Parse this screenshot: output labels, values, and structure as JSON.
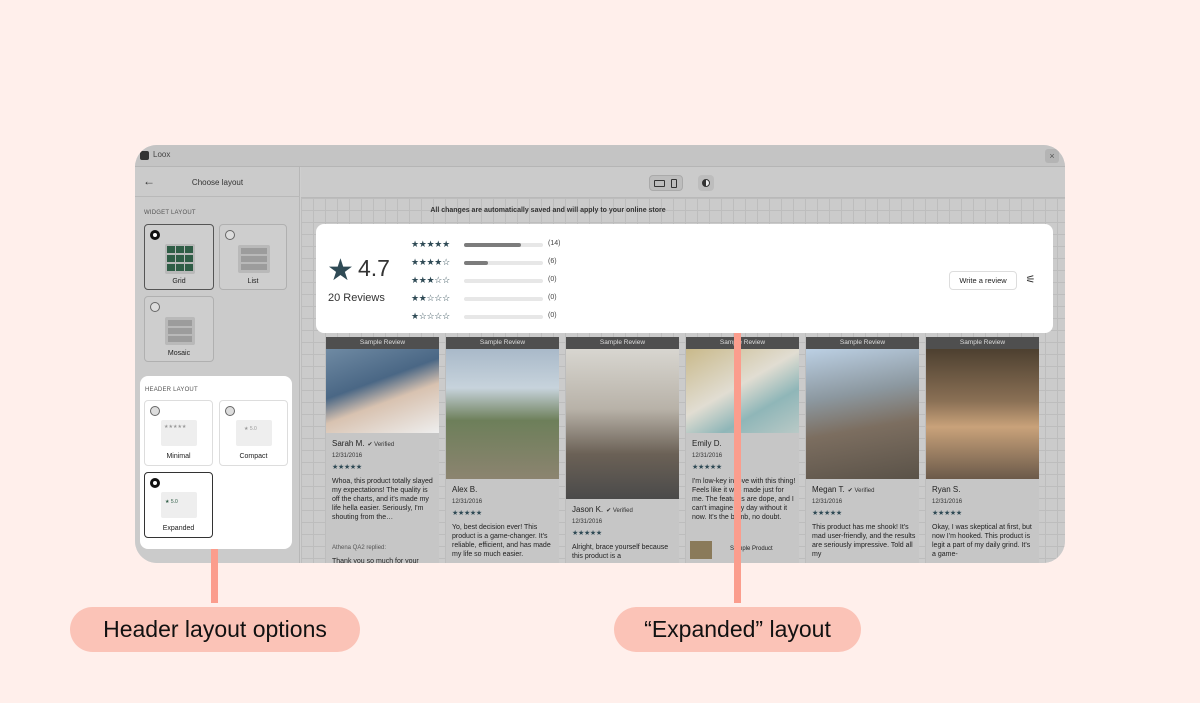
{
  "app": {
    "name": "Loox",
    "close": "×"
  },
  "sidebar": {
    "back_icon": "←",
    "title": "Choose layout",
    "widget_section": "WIDGET LAYOUT",
    "widget_options": [
      {
        "label": "Grid",
        "selected": true
      },
      {
        "label": "List",
        "selected": false
      },
      {
        "label": "Mosaic",
        "selected": false
      }
    ],
    "header_section": "HEADER LAYOUT",
    "header_options": [
      {
        "label": "Minimal",
        "selected": false,
        "preview": "★★★★★"
      },
      {
        "label": "Compact",
        "selected": false,
        "preview": "★ 5.0"
      },
      {
        "label": "Expanded",
        "selected": true,
        "preview": "★ 5.0"
      }
    ]
  },
  "toolbar": {
    "desktop_icon": "desktop-icon",
    "mobile_icon": "mobile-icon",
    "theme_icon": "contrast-icon"
  },
  "notice": "All changes are automatically saved and will apply to your online store",
  "summary": {
    "average": "4.7",
    "count_label": "20 Reviews",
    "rows": [
      {
        "stars": "★★★★★",
        "count": "(14)",
        "fraction": 0.72
      },
      {
        "stars": "★★★★☆",
        "count": "(6)",
        "fraction": 0.31
      },
      {
        "stars": "★★★☆☆",
        "count": "(0)",
        "fraction": 0
      },
      {
        "stars": "★★☆☆☆",
        "count": "(0)",
        "fraction": 0
      },
      {
        "stars": "★☆☆☆☆",
        "count": "(0)",
        "fraction": 0
      }
    ],
    "write_button": "Write a review",
    "filter_icon": "sliders-icon"
  },
  "cards": [
    {
      "tag": "Sample Review",
      "name": "Sarah M.",
      "verified": "Verified",
      "date": "12/31/2016",
      "stars": "★★★★★",
      "text": "Whoa, this product totally slayed my expectations! The quality is off the charts, and it's made my life hella easier. Seriously, I'm shouting from the…",
      "reply": "Athena QA2 replied:",
      "reply_text": "Thank you so much for your"
    },
    {
      "tag": "Sample Review",
      "name": "Alex B.",
      "verified": "",
      "date": "12/31/2016",
      "stars": "★★★★★",
      "text": "Yo, best decision ever! This product is a game-changer. It's reliable, efficient, and has made my life so much easier."
    },
    {
      "tag": "Sample Review",
      "name": "Jason K.",
      "verified": "Verified",
      "date": "12/31/2016",
      "stars": "★★★★★",
      "text": "Alright, brace yourself because this product is a"
    },
    {
      "tag": "Sample Review",
      "name": "Emily D.",
      "verified": "",
      "date": "12/31/2016",
      "stars": "★★★★★",
      "text": "I'm low-key in love with this thing! Feels like it was made just for me. The features are dope, and I can't imagine my day without it now. It's the bomb, no doubt.",
      "product": "Sample Product"
    },
    {
      "tag": "Sample Review",
      "name": "Megan T.",
      "verified": "Verified",
      "date": "12/31/2016",
      "stars": "★★★★★",
      "text": "This product has me shook! It's mad user-friendly, and the results are seriously impressive. Told all my"
    },
    {
      "tag": "Sample Review",
      "name": "Ryan S.",
      "verified": "",
      "date": "12/31/2016",
      "stars": "★★★★★",
      "text": "Okay, I was skeptical at first, but now I'm hooked. This product is legit a part of my daily grind. It's a game-"
    }
  ],
  "callouts": {
    "left": "Header layout options",
    "right": "“Expanded” layout"
  },
  "colors": {
    "background": "#ffefeb",
    "callout": "#fbc3b7",
    "pointer": "#fb9d8d",
    "star": "#2f4a55",
    "grid_thumb": "#2f5d46"
  }
}
